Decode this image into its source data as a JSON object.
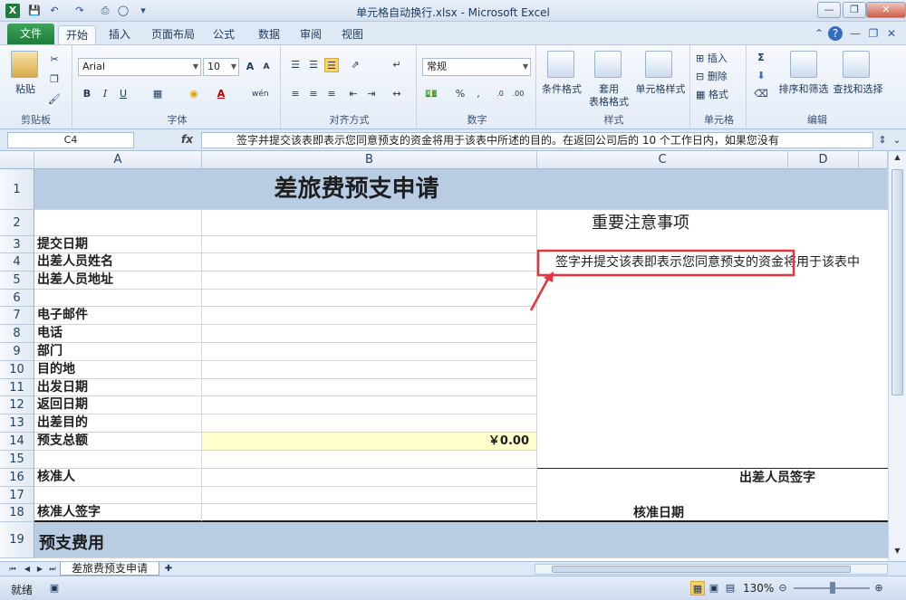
{
  "app": {
    "window_title": "单元格自动换行.xlsx - Microsoft Excel"
  },
  "tabs": {
    "file": "文件",
    "items": [
      "开始",
      "插入",
      "页面布局",
      "公式",
      "数据",
      "审阅",
      "视图"
    ]
  },
  "ribbon": {
    "clipboard": {
      "paste": "粘贴",
      "label": "剪贴板"
    },
    "font": {
      "name": "Arial",
      "size": "10",
      "label": "字体"
    },
    "alignment": {
      "label": "对齐方式"
    },
    "number": {
      "format": "常规",
      "label": "数字"
    },
    "styles": {
      "conditional": "条件格式",
      "table_fmt_1": "套用",
      "table_fmt_2": "表格格式",
      "cell_styles": "单元格样式",
      "label": "样式"
    },
    "cells": {
      "insert": "插入",
      "delete": "删除",
      "format": "格式",
      "label": "单元格"
    },
    "editing": {
      "sigma": "Σ",
      "sort_filter": "排序和筛选",
      "find_select": "查找和选择",
      "label": "编辑"
    }
  },
  "formula_bar": {
    "name_box": "C4",
    "fx": "fx",
    "content": "签字并提交该表即表示您同意预支的资金将用于该表中所述的目的。在返回公司后的 10 个工作日内，如果您没有"
  },
  "sheet": {
    "columns": [
      "A",
      "B",
      "C",
      "D"
    ],
    "rows": [
      "1",
      "2",
      "3",
      "4",
      "5",
      "6",
      "7",
      "8",
      "9",
      "10",
      "11",
      "12",
      "13",
      "14",
      "15",
      "16",
      "17",
      "18",
      "19"
    ],
    "title": "差旅费预支申请",
    "notes_title": "重要注意事项",
    "c4_text": "签字并提交该表即表示您同意预支的资金将用于该表中",
    "labels": {
      "r3": "提交日期",
      "r4": "出差人员姓名",
      "r5": "出差人员地址",
      "r7": "电子邮件",
      "r8": "电话",
      "r9": "部门",
      "r10": "目的地",
      "r11": "出发日期",
      "r12": "返回日期",
      "r13": "出差目的",
      "r14": "预支总额",
      "r16": "核准人",
      "r18": "核准人签字",
      "r19": "预支费用"
    },
    "amount": "￥0.00",
    "traveler_signature": "出差人员签字",
    "approval_date": "核准日期"
  },
  "sheet_tab": "差旅费预支申请",
  "status": {
    "ready": "就绪",
    "zoom": "130%"
  },
  "colors": {
    "header_fill": "#b8cce4",
    "amount_fill": "#ffffcc",
    "highlight_box": "#e8323c",
    "file_tab": "#2a8f48"
  }
}
